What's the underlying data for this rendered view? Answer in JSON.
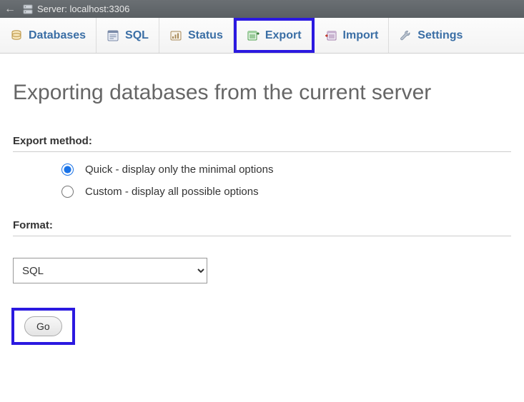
{
  "topbar": {
    "server_label": "Server: localhost:3306"
  },
  "tabs": {
    "databases": "Databases",
    "sql": "SQL",
    "status": "Status",
    "export": "Export",
    "import": "Import",
    "settings": "Settings"
  },
  "page": {
    "title": "Exporting databases from the current server",
    "export_method_heading": "Export method:",
    "option_quick": "Quick - display only the minimal options",
    "option_custom": "Custom - display all possible options",
    "format_heading": "Format:",
    "format_value": "SQL",
    "go_label": "Go"
  }
}
